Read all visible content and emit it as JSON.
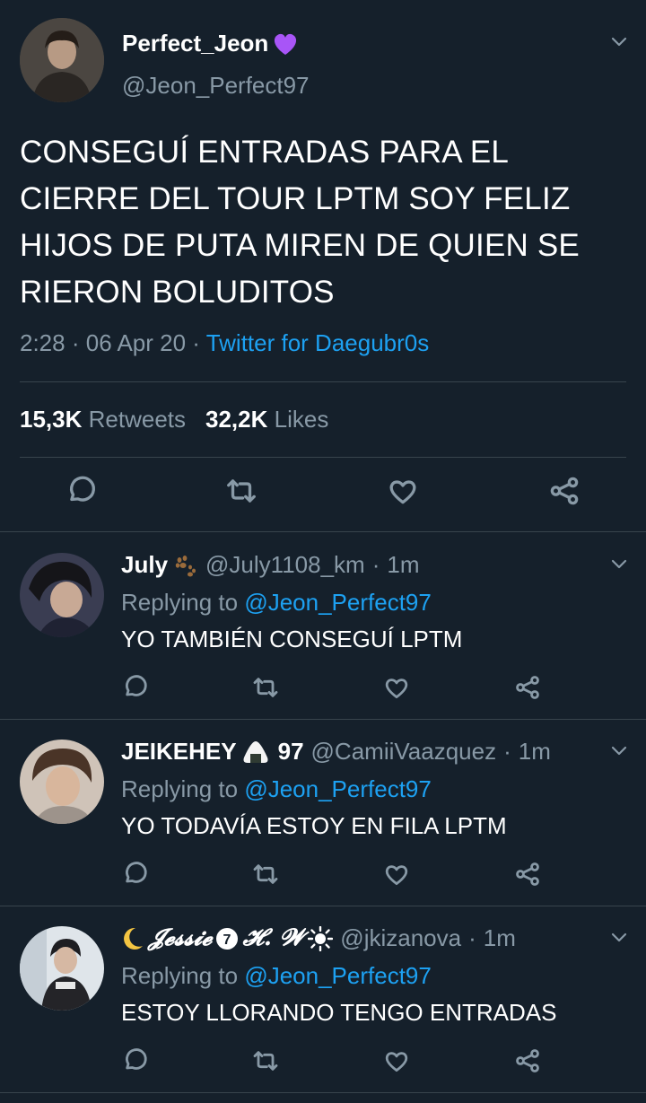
{
  "main_tweet": {
    "display_name": "Perfect_Jeon",
    "handle": "@Jeon_Perfect97",
    "text": "CONSEGUÍ ENTRADAS PARA EL CIERRE DEL TOUR LPTM SOY FELIZ HIJOS DE PUTA MIREN DE QUIEN SE RIERON BOLUDITOS",
    "time": "2:28",
    "date": "06 Apr 20",
    "source": "Twitter for Daegubr0s",
    "retweets_count": "15,3K",
    "retweets_label": "Retweets",
    "likes_count": "32,2K",
    "likes_label": "Likes"
  },
  "replies": [
    {
      "display_name": "July",
      "handle": "@July1108_km",
      "time": "1m",
      "replying_label": "Replying to",
      "replying_to": "@Jeon_Perfect97",
      "text": "YO TAMBIÉN CONSEGUÍ LPTM"
    },
    {
      "display_name": "JEIKEHEY",
      "name_suffix": "97",
      "handle": "@CamiiVaazquez",
      "time": "1m",
      "replying_label": "Replying to",
      "replying_to": "@Jeon_Perfect97",
      "text": "YO TODAVÍA ESTOY EN FILA LPTM"
    },
    {
      "display_name": "𝓙𝓮𝓼𝓼𝓲𝓮",
      "name_mid": "𝓗. 𝓦",
      "handle": "@jkizanova",
      "time": "1m",
      "replying_label": "Replying to",
      "replying_to": "@Jeon_Perfect97",
      "text": "ESTOY LLORANDO TENGO ENTRADAS"
    }
  ],
  "icons": [
    "reply-icon",
    "retweet-icon",
    "like-icon",
    "share-icon",
    "chevron-down-icon",
    "purple-heart-icon",
    "paw-icon",
    "rice-ball-icon",
    "moon-icon",
    "sun-icon"
  ],
  "colors": {
    "background": "#15202b",
    "muted": "#8899a6",
    "accent": "#1da1f2",
    "divider": "#38444d",
    "purple_heart": "#a855f7"
  }
}
